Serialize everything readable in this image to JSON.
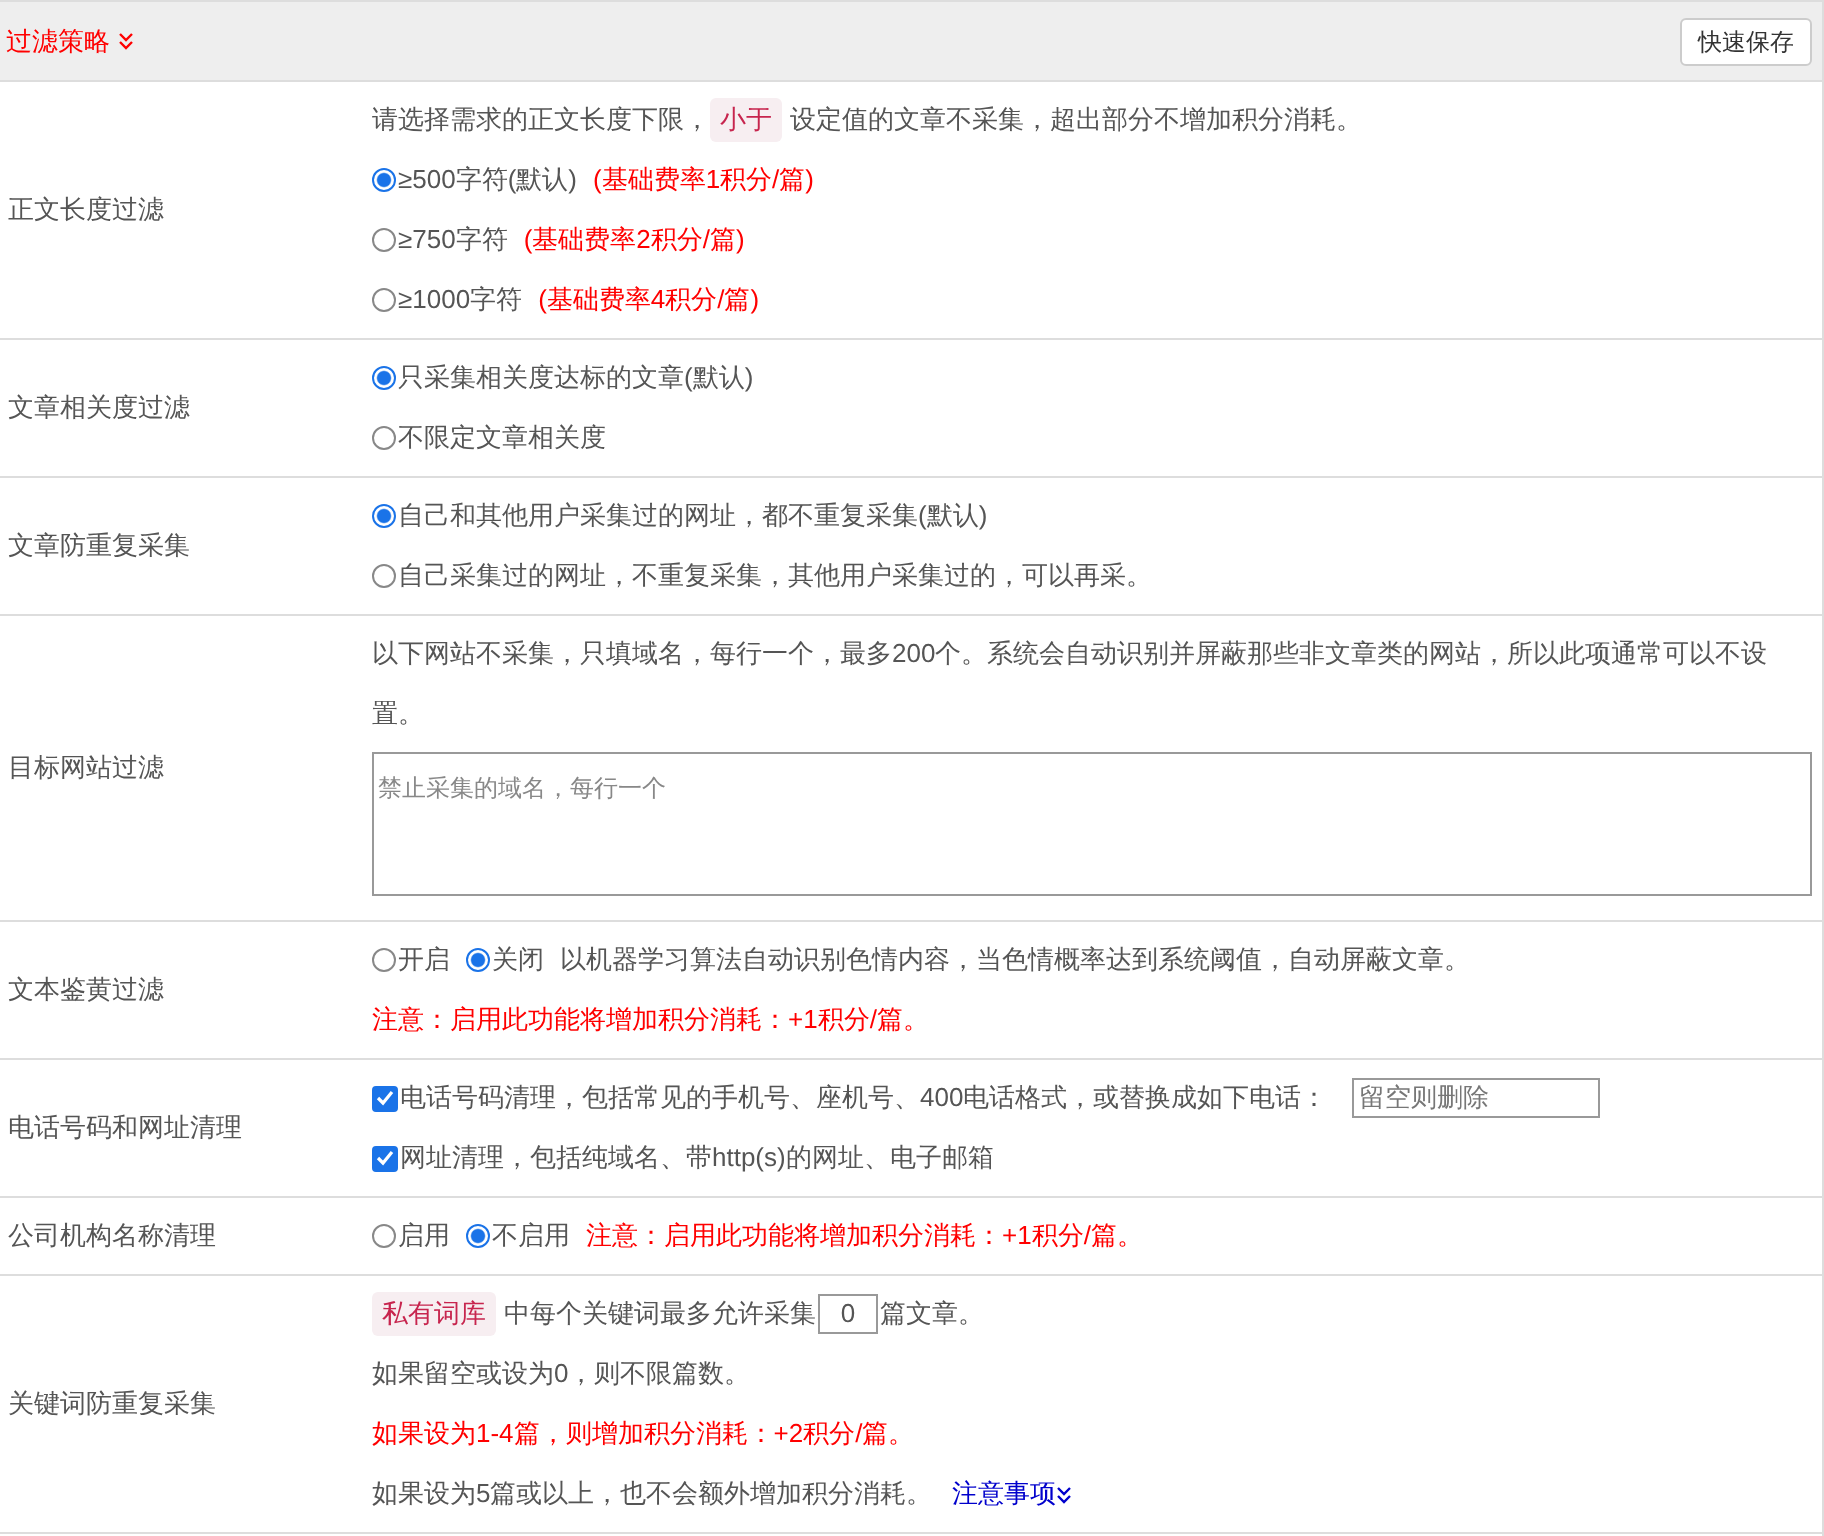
{
  "header": {
    "title": "过滤策略",
    "button": "快速保存"
  },
  "rows": [
    {
      "label": "正文长度过滤",
      "lines": [
        {
          "parts": [
            {
              "kind": "text",
              "text": "请选择需求的正文长度下限，"
            },
            {
              "kind": "tag",
              "text": "小于"
            },
            {
              "kind": "text",
              "text": "设定值的文章不采集，超出部分不增加积分消耗。"
            }
          ]
        },
        {
          "parts": [
            {
              "kind": "radio",
              "label": "≥500字符(默认)",
              "selected": true
            },
            {
              "kind": "note",
              "text": "(基础费率1积分/篇)"
            }
          ]
        },
        {
          "parts": [
            {
              "kind": "radio",
              "label": "≥750字符",
              "selected": false
            },
            {
              "kind": "note",
              "text": "(基础费率2积分/篇)"
            }
          ]
        },
        {
          "parts": [
            {
              "kind": "radio",
              "label": "≥1000字符",
              "selected": false
            },
            {
              "kind": "note",
              "text": "(基础费率4积分/篇)"
            }
          ]
        }
      ]
    },
    {
      "label": "文章相关度过滤",
      "lines": [
        {
          "parts": [
            {
              "kind": "radio",
              "label": "只采集相关度达标的文章(默认)",
              "selected": true
            }
          ]
        },
        {
          "parts": [
            {
              "kind": "radio",
              "label": "不限定文章相关度",
              "selected": false
            }
          ]
        }
      ]
    },
    {
      "label": "文章防重复采集",
      "lines": [
        {
          "parts": [
            {
              "kind": "radio",
              "label": "自己和其他用户采集过的网址，都不重复采集(默认)",
              "selected": true
            }
          ]
        },
        {
          "parts": [
            {
              "kind": "radio",
              "label": "自己采集过的网址，不重复采集，其他用户采集过的，可以再采。",
              "selected": false
            }
          ]
        }
      ]
    },
    {
      "label": "目标网站过滤",
      "lines": [
        {
          "parts": [
            {
              "kind": "text",
              "text": "以下网站不采集，只填域名，每行一个，最多200个。系统会自动识别并屏蔽那些非文章类的网站，所以此项通常可以不设置。"
            }
          ]
        },
        {
          "parts": [
            {
              "kind": "textarea",
              "placeholder": "禁止采集的域名，每行一个"
            }
          ]
        }
      ]
    },
    {
      "label": "文本鉴黄过滤",
      "lines": [
        {
          "parts": [
            {
              "kind": "radio",
              "label": "开启",
              "selected": false
            },
            {
              "kind": "radio",
              "label": "关闭",
              "selected": true
            },
            {
              "kind": "text",
              "text": "以机器学习算法自动识别色情内容，当色情概率达到系统阈值，自动屏蔽文章。"
            }
          ]
        },
        {
          "parts": [
            {
              "kind": "note",
              "text": "注意：启用此功能将增加积分消耗：+1积分/篇。"
            }
          ]
        }
      ]
    },
    {
      "label": "电话号码和网址清理",
      "lines": [
        {
          "parts": [
            {
              "kind": "checkbox",
              "label": "电话号码清理，包括常见的手机号、座机号、400电话格式，或替换成如下电话：",
              "checked": true
            },
            {
              "kind": "input",
              "placeholder": "留空则删除"
            }
          ]
        },
        {
          "parts": [
            {
              "kind": "checkbox",
              "label": "网址清理，包括纯域名、带http(s)的网址、电子邮箱",
              "checked": true
            }
          ]
        }
      ]
    },
    {
      "label": "公司机构名称清理",
      "lines": [
        {
          "parts": [
            {
              "kind": "radio",
              "label": "启用",
              "selected": false
            },
            {
              "kind": "radio",
              "label": "不启用",
              "selected": true
            },
            {
              "kind": "note",
              "text": "注意：启用此功能将增加积分消耗：+1积分/篇。"
            }
          ]
        }
      ]
    },
    {
      "label": "关键词防重复采集",
      "lines": [
        {
          "parts": [
            {
              "kind": "tag",
              "text": "私有词库"
            },
            {
              "kind": "text",
              "text": "中每个关键词最多允许采集"
            },
            {
              "kind": "number",
              "value": "0"
            },
            {
              "kind": "text",
              "text": "篇文章。"
            }
          ]
        },
        {
          "parts": [
            {
              "kind": "text",
              "text": "如果留空或设为0，则不限篇数。"
            }
          ]
        },
        {
          "parts": [
            {
              "kind": "note",
              "text": "如果设为1-4篇，则增加积分消耗：+2积分/篇。"
            }
          ]
        },
        {
          "parts": [
            {
              "kind": "text",
              "text": "如果设为5篇或以上，也不会额外增加积分消耗。"
            },
            {
              "kind": "link",
              "text": "注意事项"
            }
          ]
        }
      ]
    }
  ]
}
